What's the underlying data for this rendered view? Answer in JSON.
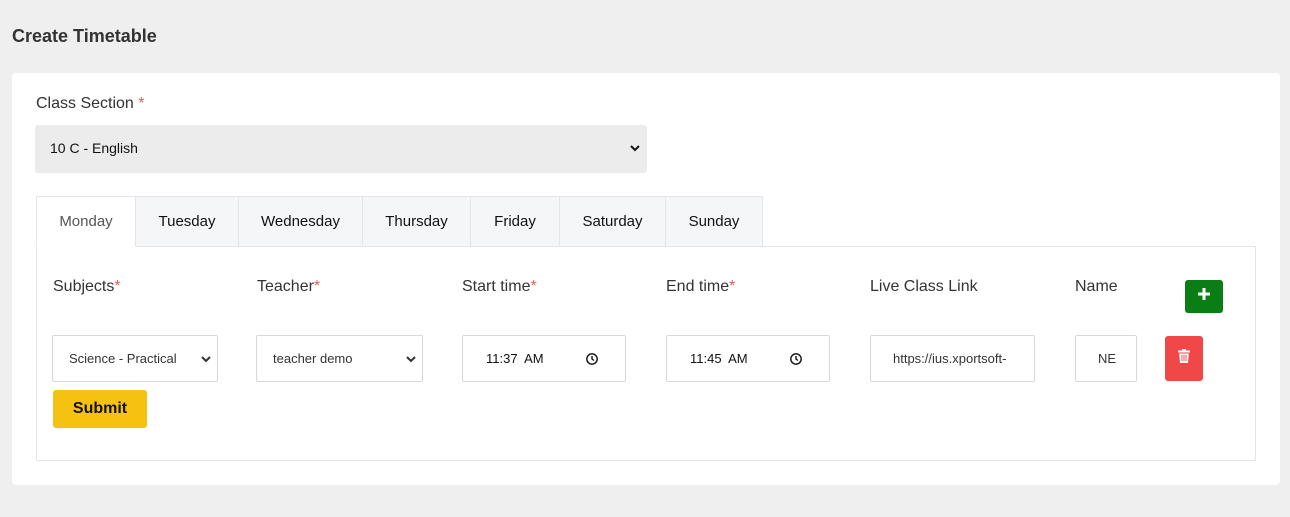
{
  "page": {
    "title": "Create Timetable"
  },
  "class_section": {
    "label": "Class Section",
    "required_mark": "*",
    "value": "10 C - English"
  },
  "tabs": [
    {
      "label": "Monday",
      "active": true
    },
    {
      "label": "Tuesday"
    },
    {
      "label": "Wednesday"
    },
    {
      "label": "Thursday"
    },
    {
      "label": "Friday"
    },
    {
      "label": "Saturday"
    },
    {
      "label": "Sunday"
    }
  ],
  "columns": {
    "subjects": "Subjects",
    "teacher": "Teacher",
    "start_time": "Start time",
    "end_time": "End time",
    "live_class_link": "Live Class Link",
    "name": "Name",
    "required_mark": "*"
  },
  "row": {
    "subject": "Science - Practical",
    "teacher": "teacher demo",
    "start_time": "11:37  AM",
    "end_time": "11:45  AM",
    "live_class_link": "https://ius.xportsoft-",
    "name": "NE"
  },
  "buttons": {
    "submit": "Submit"
  },
  "icons": {
    "add": "plus-icon",
    "delete": "trash-icon",
    "clock": "clock-icon",
    "dropdown": "chevron-down-icon"
  },
  "colors": {
    "add": "#0a7d14",
    "delete": "#f04848",
    "submit": "#f5c211",
    "required": "#e06060"
  }
}
